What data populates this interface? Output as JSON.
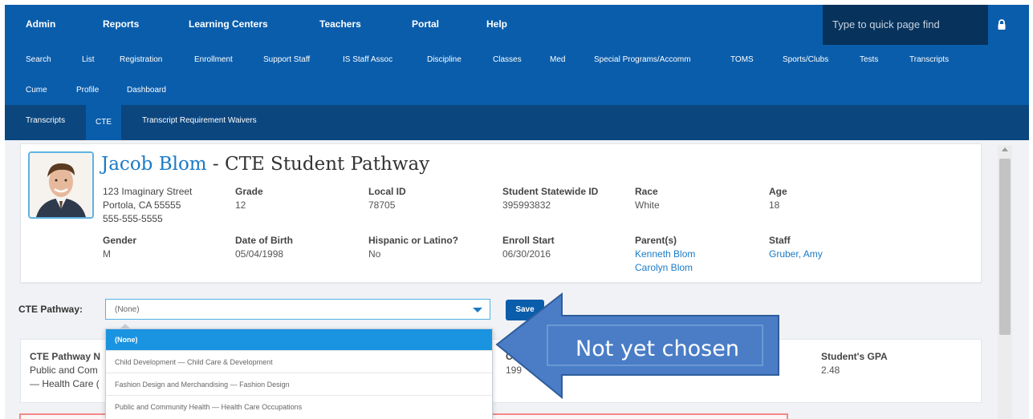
{
  "topnav": {
    "items": [
      "Admin",
      "Reports",
      "Learning Centers",
      "Teachers",
      "Portal",
      "Help"
    ],
    "quickfind_placeholder": "Type to quick page find",
    "lock_icon": "lock-icon"
  },
  "subnav": {
    "row1": [
      "Search",
      "List",
      "Registration",
      "Enrollment",
      "Support Staff",
      "IS Staff Assoc",
      "Discipline",
      "Classes",
      "Med",
      "Special Programs/Accomm",
      "TOMS",
      "Sports/Clubs",
      "Tests",
      "Transcripts"
    ],
    "row2": [
      "Cume",
      "Profile",
      "Dashboard"
    ]
  },
  "tabs": [
    "Transcripts",
    "CTE",
    "Transcript Requirement Waivers"
  ],
  "student": {
    "name": "Jacob Blom",
    "title_suffix": " - CTE Student Pathway",
    "address": [
      "123 Imaginary Street",
      "Portola, CA 55555",
      "555-555-5555"
    ],
    "grade_label": "Grade",
    "grade": "12",
    "localid_label": "Local ID",
    "localid": "78705",
    "ssid_label": "Student Statewide ID",
    "ssid": "395993832",
    "race_label": "Race",
    "race": "White",
    "age_label": "Age",
    "age": "18",
    "gender_label": "Gender",
    "gender": "M",
    "dob_label": "Date of Birth",
    "dob": "05/04/1998",
    "hispanic_label": "Hispanic or Latino?",
    "hispanic": "No",
    "enroll_label": "Enroll Start",
    "enroll": "06/30/2016",
    "parents_label": "Parent(s)",
    "parents": [
      "Kenneth Blom",
      "Carolyn Blom"
    ],
    "staff_label": "Staff",
    "staff": "Gruber, Amy"
  },
  "cte": {
    "label": "CTE Pathway:",
    "selected": "(None)",
    "save_label": "Save",
    "options": [
      "(None)",
      "Child Development — Child Care & Development",
      "Fashion Design and Merchandising — Fashion Design",
      "Public and Community Health — Health Care Occupations"
    ]
  },
  "card2": {
    "pathway_label": "CTE Pathway N",
    "pathway_line1": "Public and Com",
    "pathway_line2": "— Health Care (",
    "c_label": "C",
    "c_value": "199",
    "gpa_label": "Student's GPA",
    "gpa_value": "2.48"
  },
  "callout": {
    "text": "Not yet chosen"
  },
  "colors": {
    "nav": "#0a5dab",
    "tabs": "#0b467f",
    "accent": "#1b7ac6",
    "callout": "#4a7dc6"
  }
}
